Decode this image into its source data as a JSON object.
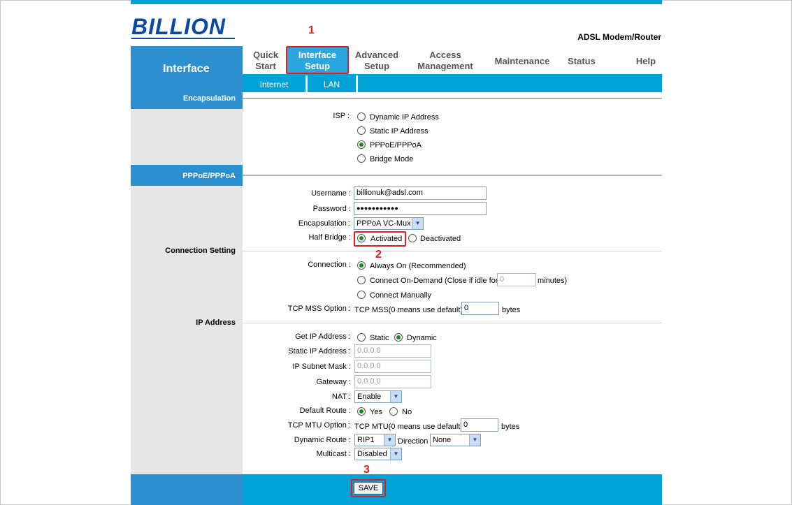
{
  "brand": {
    "logo_text": "BILLION",
    "product": "ADSL Modem/Router"
  },
  "sidebar": {
    "title": "Interface",
    "encapsulation_header": "Encapsulation",
    "pppoe_header": "PPPoE/PPPoA",
    "connection_setting": "Connection Setting",
    "ip_address": "IP Address"
  },
  "nav": {
    "quick_start": "Quick Start",
    "interface_setup": "Interface Setup",
    "advanced_setup": "Advanced Setup",
    "access_management": "Access Management",
    "maintenance": "Maintenance",
    "status": "Status",
    "help": "Help",
    "sub": {
      "internet": "Internet",
      "lan": "LAN"
    }
  },
  "isp": {
    "label": "ISP :",
    "options": [
      "Dynamic IP Address",
      "Static IP Address",
      "PPPoE/PPPoA",
      "Bridge Mode"
    ],
    "selected": "PPPoE/PPPoA"
  },
  "pppoe": {
    "username_label": "Username :",
    "username": "billionuk@adsl.com",
    "password_label": "Password :",
    "password": "●●●●●●●●●●●",
    "encapsulation_label": "Encapsulation :",
    "encapsulation": "PPPoA VC-Mux",
    "half_bridge_label": "Half Bridge :",
    "activated": "Activated",
    "deactivated": "Deactivated"
  },
  "connection": {
    "label": "Connection :",
    "always_on": "Always On (Recommended)",
    "on_demand": "Connect On-Demand (Close if idle for",
    "idle_value": "0",
    "minutes": "minutes)",
    "manual": "Connect Manually",
    "tcp_mss_label": "TCP MSS Option :",
    "tcp_mss_text": "TCP MSS(0 means use default)",
    "tcp_mss_value": "0",
    "bytes": "bytes"
  },
  "ip": {
    "get_ip_label": "Get IP Address :",
    "static": "Static",
    "dynamic": "Dynamic",
    "static_ip_label": "Static IP Address :",
    "static_ip": "0.0.0.0",
    "subnet_label": "IP Subnet Mask :",
    "subnet": "0.0.0.0",
    "gateway_label": "Gateway :",
    "gateway": "0.0.0.0",
    "nat_label": "NAT :",
    "nat": "Enable",
    "default_route_label": "Default Route :",
    "yes": "Yes",
    "no": "No",
    "tcp_mtu_label": "TCP MTU Option :",
    "tcp_mtu_text": "TCP MTU(0 means use default)",
    "tcp_mtu_value": "0",
    "bytes": "bytes",
    "dynamic_route_label": "Dynamic Route :",
    "dynamic_route": "RIP1",
    "direction_label": "Direction",
    "direction": "None",
    "multicast_label": "Multicast :",
    "multicast": "Disabled"
  },
  "save_label": "SAVE",
  "annotations": {
    "one": "1",
    "two": "2",
    "three": "3"
  },
  "colors": {
    "accent": "#00a2d8",
    "sidebar_blue": "#2b8fd0",
    "highlight": "#e02020"
  }
}
